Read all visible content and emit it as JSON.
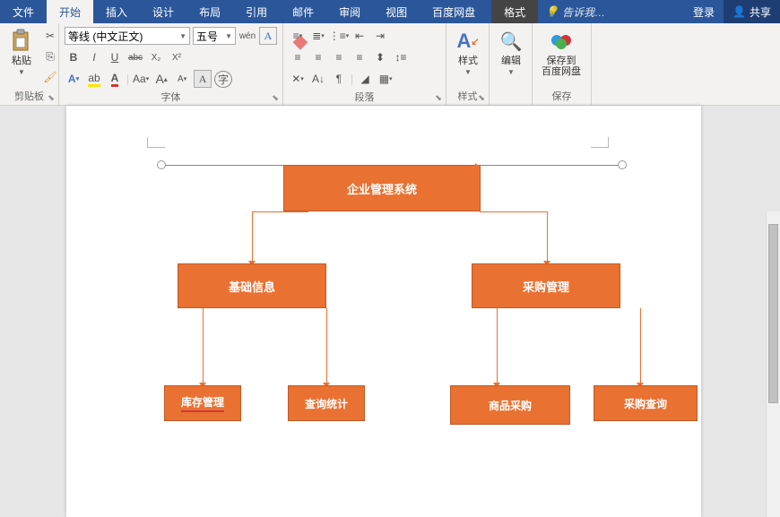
{
  "menu": {
    "tabs": [
      "文件",
      "开始",
      "插入",
      "设计",
      "布局",
      "引用",
      "邮件",
      "审阅",
      "视图",
      "百度网盘"
    ],
    "active_index": 1,
    "context_tab": "格式",
    "tellme_placeholder": "告诉我…",
    "login": "登录",
    "share": "共享"
  },
  "ribbon": {
    "clipboard": {
      "paste": "粘贴",
      "label": "剪贴板"
    },
    "font": {
      "label": "字体",
      "font_name": "等线 (中文正文)",
      "font_size": "五号",
      "ruby": "wén",
      "boxedA": "A",
      "bold": "B",
      "italic": "I",
      "underline": "U",
      "strike": "abc",
      "sub": "X₂",
      "sup": "X²",
      "clear": "◆"
    },
    "paragraph": {
      "label": "段落"
    },
    "styles": {
      "label": "样式",
      "btn": "样式"
    },
    "editing": {
      "label": "编辑",
      "btn": "编辑"
    },
    "save": {
      "label": "保存",
      "btn": "保存到\n百度网盘"
    }
  },
  "diagram": {
    "root": "企业管理系统",
    "n1": "基础信息",
    "n2": "采购管理",
    "n1a": "库存管理",
    "n1b": "查询统计",
    "n2a": "商品采购",
    "n2b": "采购查询"
  }
}
